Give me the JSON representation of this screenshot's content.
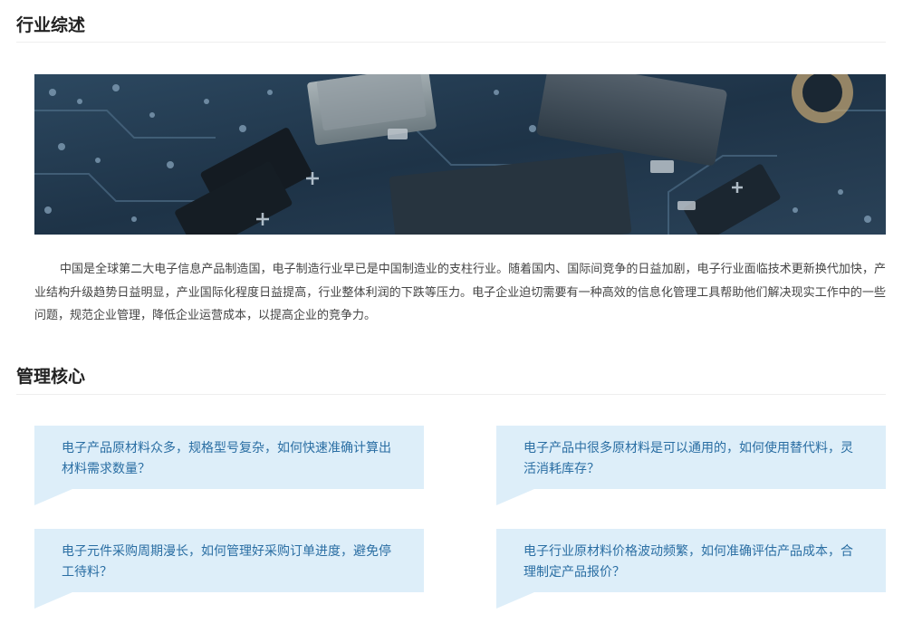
{
  "overview": {
    "title": "行业综述",
    "banner": "circuit-board-photo",
    "paragraph": "中国是全球第二大电子信息产品制造国，电子制造行业早已是中国制造业的支柱行业。随着国内、国际间竞争的日益加剧，电子行业面临技术更新换代加快，产业结构升级趋势日益明显，产业国际化程度日益提高，行业整体利润的下跌等压力。电子企业迫切需要有一种高效的信息化管理工具帮助他们解决现实工作中的一些问题，规范企业管理，降低企业运营成本，以提高企业的竞争力。"
  },
  "core": {
    "title": "管理核心",
    "cards": [
      {
        "text": "电子产品原材料众多，规格型号复杂，如何快速准确计算出材料需求数量？"
      },
      {
        "text": "电子产品中很多原材料是可以通用的，如何使用替代料，灵活消耗库存？"
      },
      {
        "text": "电子元件采购周期漫长，如何管理好采购订单进度，避免停工待料？"
      },
      {
        "text": "电子行业原材料价格波动频繁，如何准确评估产品成本，合理制定产品报价？"
      }
    ]
  },
  "colors": {
    "heading": "#222222",
    "card_bg": "#ddeef9",
    "card_text": "#2a6ea3",
    "body_text": "#444444"
  }
}
